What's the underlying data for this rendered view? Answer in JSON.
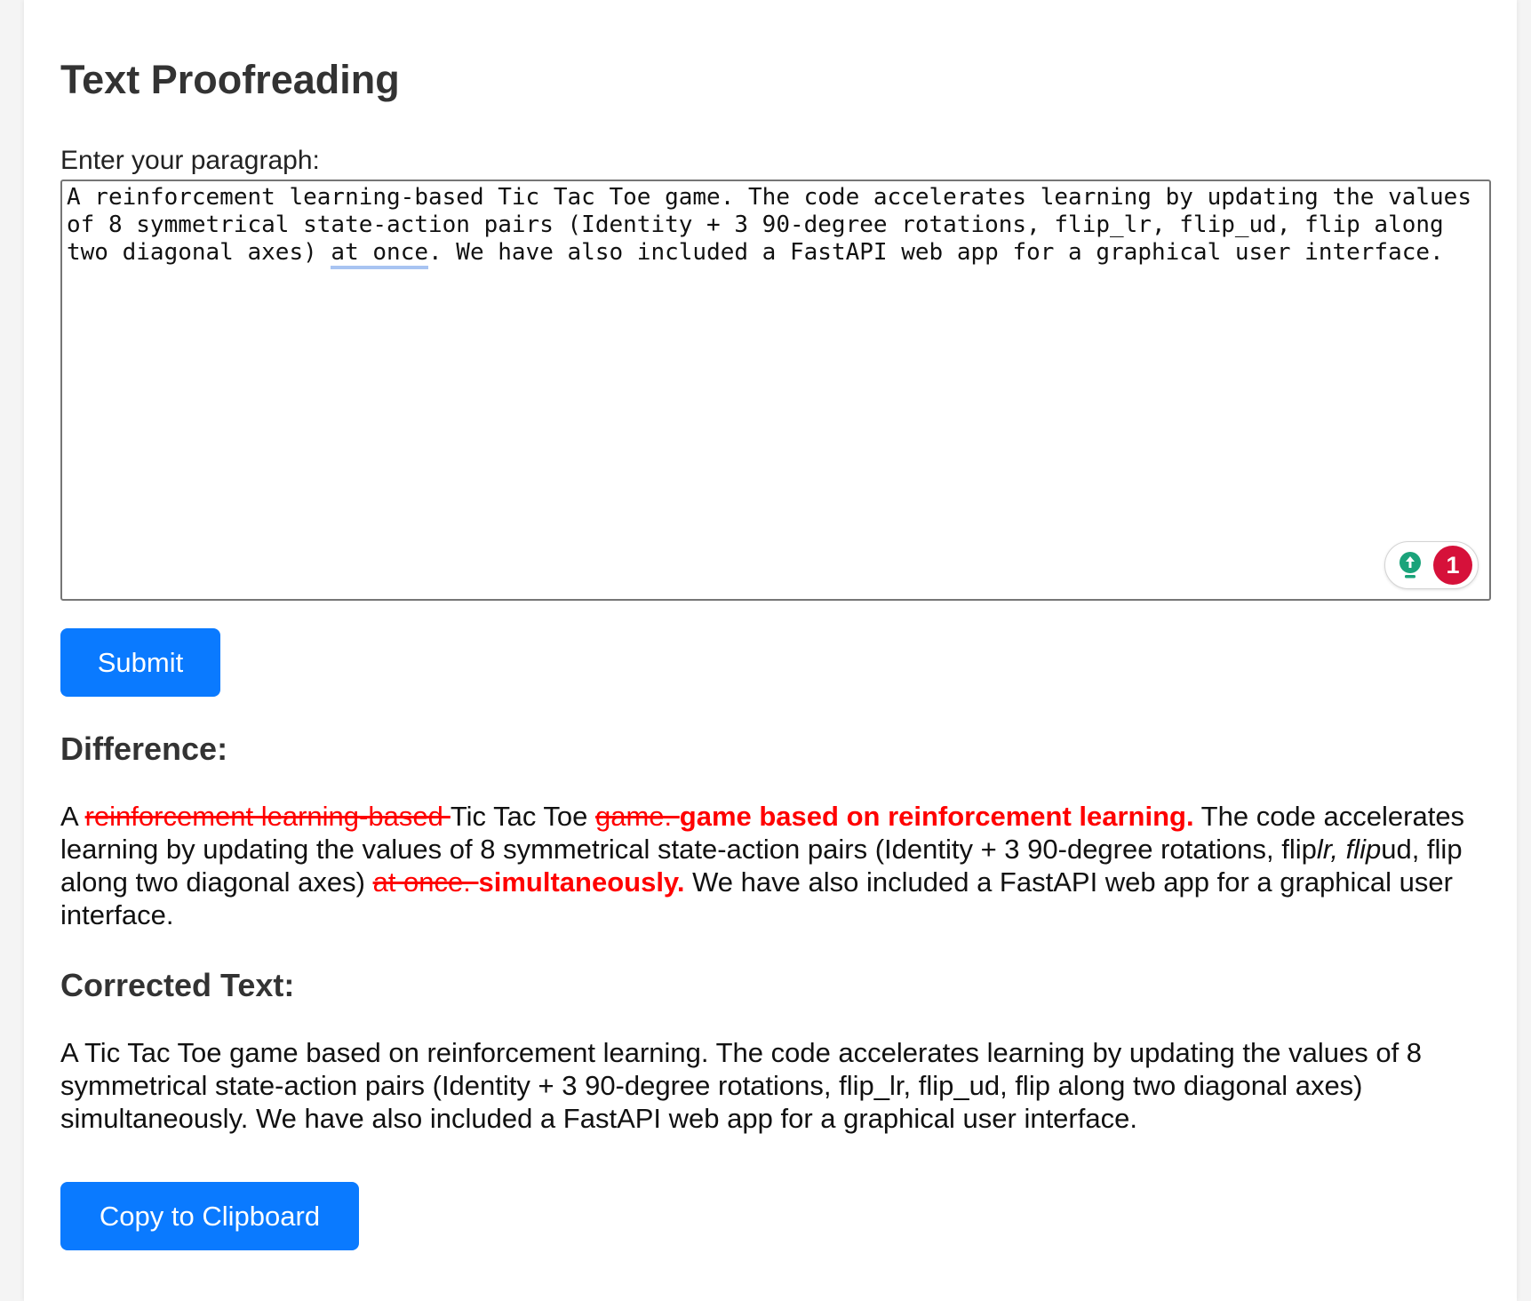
{
  "page": {
    "title": "Text Proofreading",
    "input_label": "Enter your paragraph:",
    "submit_label": "Submit",
    "copy_label": "Copy to Clipboard"
  },
  "input": {
    "text_before": "A reinforcement learning-based Tic Tac Toe game. The code accelerates learning by updating the values of 8 symmetrical state-action pairs (Identity + 3 90-degree rotations, flip_lr, flip_ud, flip along two diagonal axes) ",
    "flagged_phrase": "at once",
    "text_after": ". We have also included a FastAPI web app for a graphical user interface."
  },
  "grammar_widget": {
    "icon": "lightbulb-icon",
    "issue_count": "1",
    "accent_color": "#1aa37a",
    "badge_color": "#d6113a"
  },
  "difference": {
    "heading": "Difference:",
    "seg1": "A ",
    "del1": "reinforcement learning-based ",
    "seg2": "Tic Tac Toe ",
    "del2": "game. ",
    "ins1": "game based on reinforcement learning.",
    "seg3": " The code accelerates learning by updating the values of 8 symmetrical state-action pairs (Identity + 3 90-degree rotations, flip",
    "ital1": "lr, flip",
    "seg4": "ud, flip along two diagonal axes) ",
    "del3": "at once. ",
    "ins2": "simultaneously.",
    "seg5": " We have also included a FastAPI web app for a graphical user interface."
  },
  "corrected": {
    "heading": "Corrected Text:",
    "text": "A Tic Tac Toe game based on reinforcement learning. The code accelerates learning by updating the values of 8 symmetrical state-action pairs (Identity + 3 90-degree rotations, flip_lr, flip_ud, flip along two diagonal axes) simultaneously. We have also included a FastAPI web app for a graphical user interface."
  },
  "colors": {
    "primary_button": "#0a7aff",
    "diff_highlight": "#ff0000",
    "spell_underline": "#a8c4f2"
  }
}
